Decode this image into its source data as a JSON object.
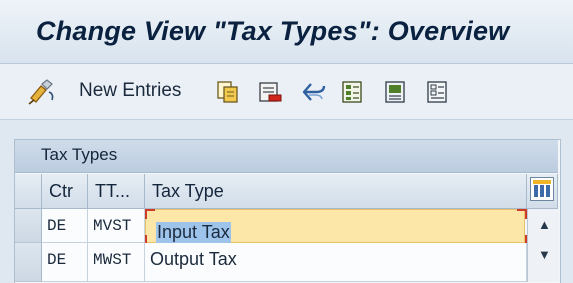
{
  "window": {
    "title": "Change View \"Tax Types\": Overview"
  },
  "toolbar": {
    "new_entries_label": "New Entries",
    "icons": [
      "display-change-icon",
      "copy-icon",
      "delete-icon",
      "undo-icon",
      "select-all-icon",
      "select-block-icon",
      "deselect-all-icon"
    ]
  },
  "table": {
    "caption": "Tax Types",
    "columns": [
      "Ctr",
      "TT...",
      "Tax Type"
    ],
    "rows": [
      {
        "ctr": "DE",
        "tt": "MVST",
        "tax_type": "Input Tax"
      },
      {
        "ctr": "DE",
        "tt": "MWST",
        "tax_type": "Output Tax"
      }
    ]
  },
  "colors": {
    "title_text": "#0a2240",
    "active_cell": "#fde7a8",
    "selection_highlight": "#9fc4ec",
    "field_corner_marks": "#d03a2a"
  }
}
